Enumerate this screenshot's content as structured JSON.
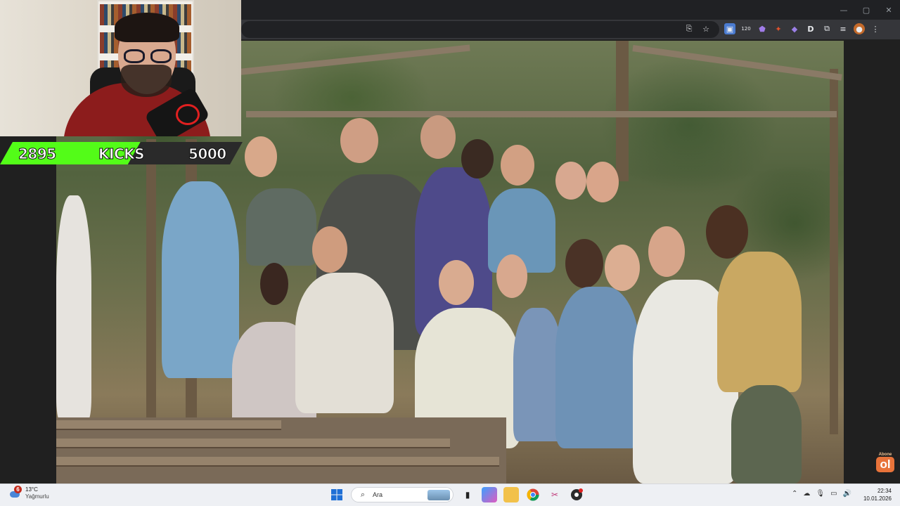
{
  "window": {
    "minimize": "—",
    "maximize": "▢",
    "close": "✕"
  },
  "kicks": {
    "current": "2895",
    "label": "KICKS",
    "goal": "5000",
    "progress": 0.579,
    "colors": {
      "fill": "#53fc18",
      "track": "#2a2a2a"
    }
  },
  "watermark": {
    "small": "Abone",
    "big": "ol"
  },
  "extensions": {
    "badge_count": "120"
  },
  "taskbar": {
    "weather": {
      "temp": "13°C",
      "condition": "Yağmurlu",
      "badge": "6"
    },
    "search_placeholder": "Ara",
    "clock": {
      "time": "22:34",
      "date": "10.01.2026"
    }
  },
  "colors": {
    "accent": "#53fc18",
    "taskbar": "#eef0f4"
  }
}
